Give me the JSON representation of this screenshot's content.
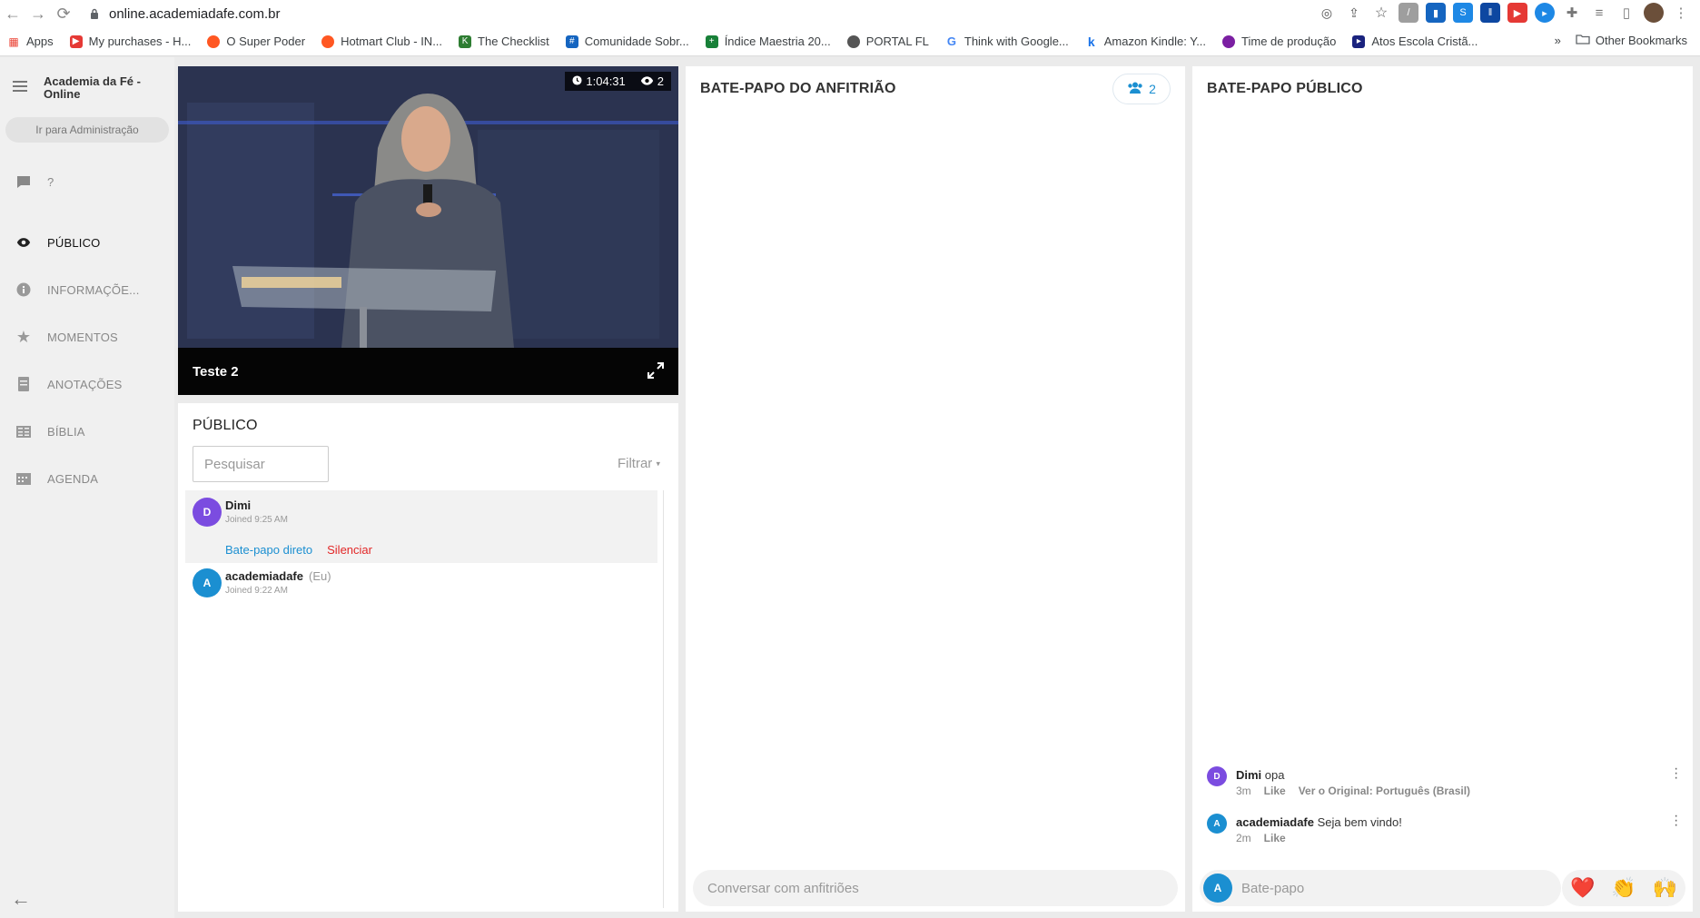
{
  "browser": {
    "url": "online.academiadafe.com.br",
    "bookmarks": [
      {
        "label": "Apps",
        "color": "#ea4335"
      },
      {
        "label": "My purchases - H...",
        "color": "#e53935"
      },
      {
        "label": "O Super Poder",
        "color": "#ff5722"
      },
      {
        "label": "Hotmart Club - IN...",
        "color": "#ff5722"
      },
      {
        "label": "The Checklist",
        "color": "#2e7d32"
      },
      {
        "label": "Comunidade Sobr...",
        "color": "#1565c0"
      },
      {
        "label": "Índice Maestria 20...",
        "color": "#188038"
      },
      {
        "label": "PORTAL FL",
        "color": "#555555"
      },
      {
        "label": "Think with Google...",
        "color": "#4285f4"
      },
      {
        "label": "Amazon Kindle: Y...",
        "color": "#1a73e8"
      },
      {
        "label": "Time de produção",
        "color": "#7b1fa2"
      },
      {
        "label": "Atos Escola Cristã...",
        "color": "#1a237e"
      }
    ],
    "more": "»",
    "other_bookmarks": "Other Bookmarks"
  },
  "sidebar": {
    "org_name": "Academia da Fé - Online",
    "admin_button": "Ir para Administração",
    "items": [
      {
        "label": "?",
        "icon": "chat-icon"
      },
      {
        "label": "PÚBLICO",
        "icon": "eye-icon"
      },
      {
        "label": "INFORMAÇÕE...",
        "icon": "info-icon"
      },
      {
        "label": "MOMENTOS",
        "icon": "star-icon"
      },
      {
        "label": "ANOTAÇÕES",
        "icon": "notes-icon"
      },
      {
        "label": "BÍBLIA",
        "icon": "bible-icon"
      },
      {
        "label": "AGENDA",
        "icon": "calendar-icon"
      }
    ]
  },
  "video": {
    "duration": "1:04:31",
    "viewers": "2",
    "title": "Teste 2"
  },
  "public_panel": {
    "heading": "PÚBLICO",
    "search_placeholder": "Pesquisar",
    "filter_label": "Filtrar",
    "people": [
      {
        "initial": "D",
        "name": "Dimi",
        "joined": "Joined 9:25 AM",
        "color": "#7b4ce0",
        "me": "",
        "action_chat": "Bate-papo direto",
        "action_mute": "Silenciar"
      },
      {
        "initial": "A",
        "name": "academiadafe",
        "joined": "Joined 9:22 AM",
        "color": "#1b8fd1",
        "me": "(Eu)"
      }
    ]
  },
  "host_chat": {
    "heading": "BATE-PAPO DO ANFITRIÃO",
    "host_count": "2",
    "input_placeholder": "Conversar com anfitriões"
  },
  "public_chat": {
    "heading": "BATE-PAPO PÚBLICO",
    "messages": [
      {
        "initial": "D",
        "author": "Dimi",
        "text": " opa",
        "time": "3m",
        "like": "Like",
        "translate": "Ver o Original: Português (Brasil)",
        "color": "#7b4ce0"
      },
      {
        "initial": "A",
        "author": "academiadafe",
        "text": " Seja bem vindo!",
        "time": "2m",
        "like": "Like",
        "translate": "",
        "color": "#1b8fd1"
      }
    ],
    "input_initial": "A",
    "input_placeholder": "Bate-papo",
    "reactions": [
      "❤️",
      "👏",
      "🙌"
    ]
  },
  "colors": {
    "accent_blue": "#1b8fd1",
    "danger_red": "#e22727",
    "avatar_purple": "#7b4ce0"
  }
}
